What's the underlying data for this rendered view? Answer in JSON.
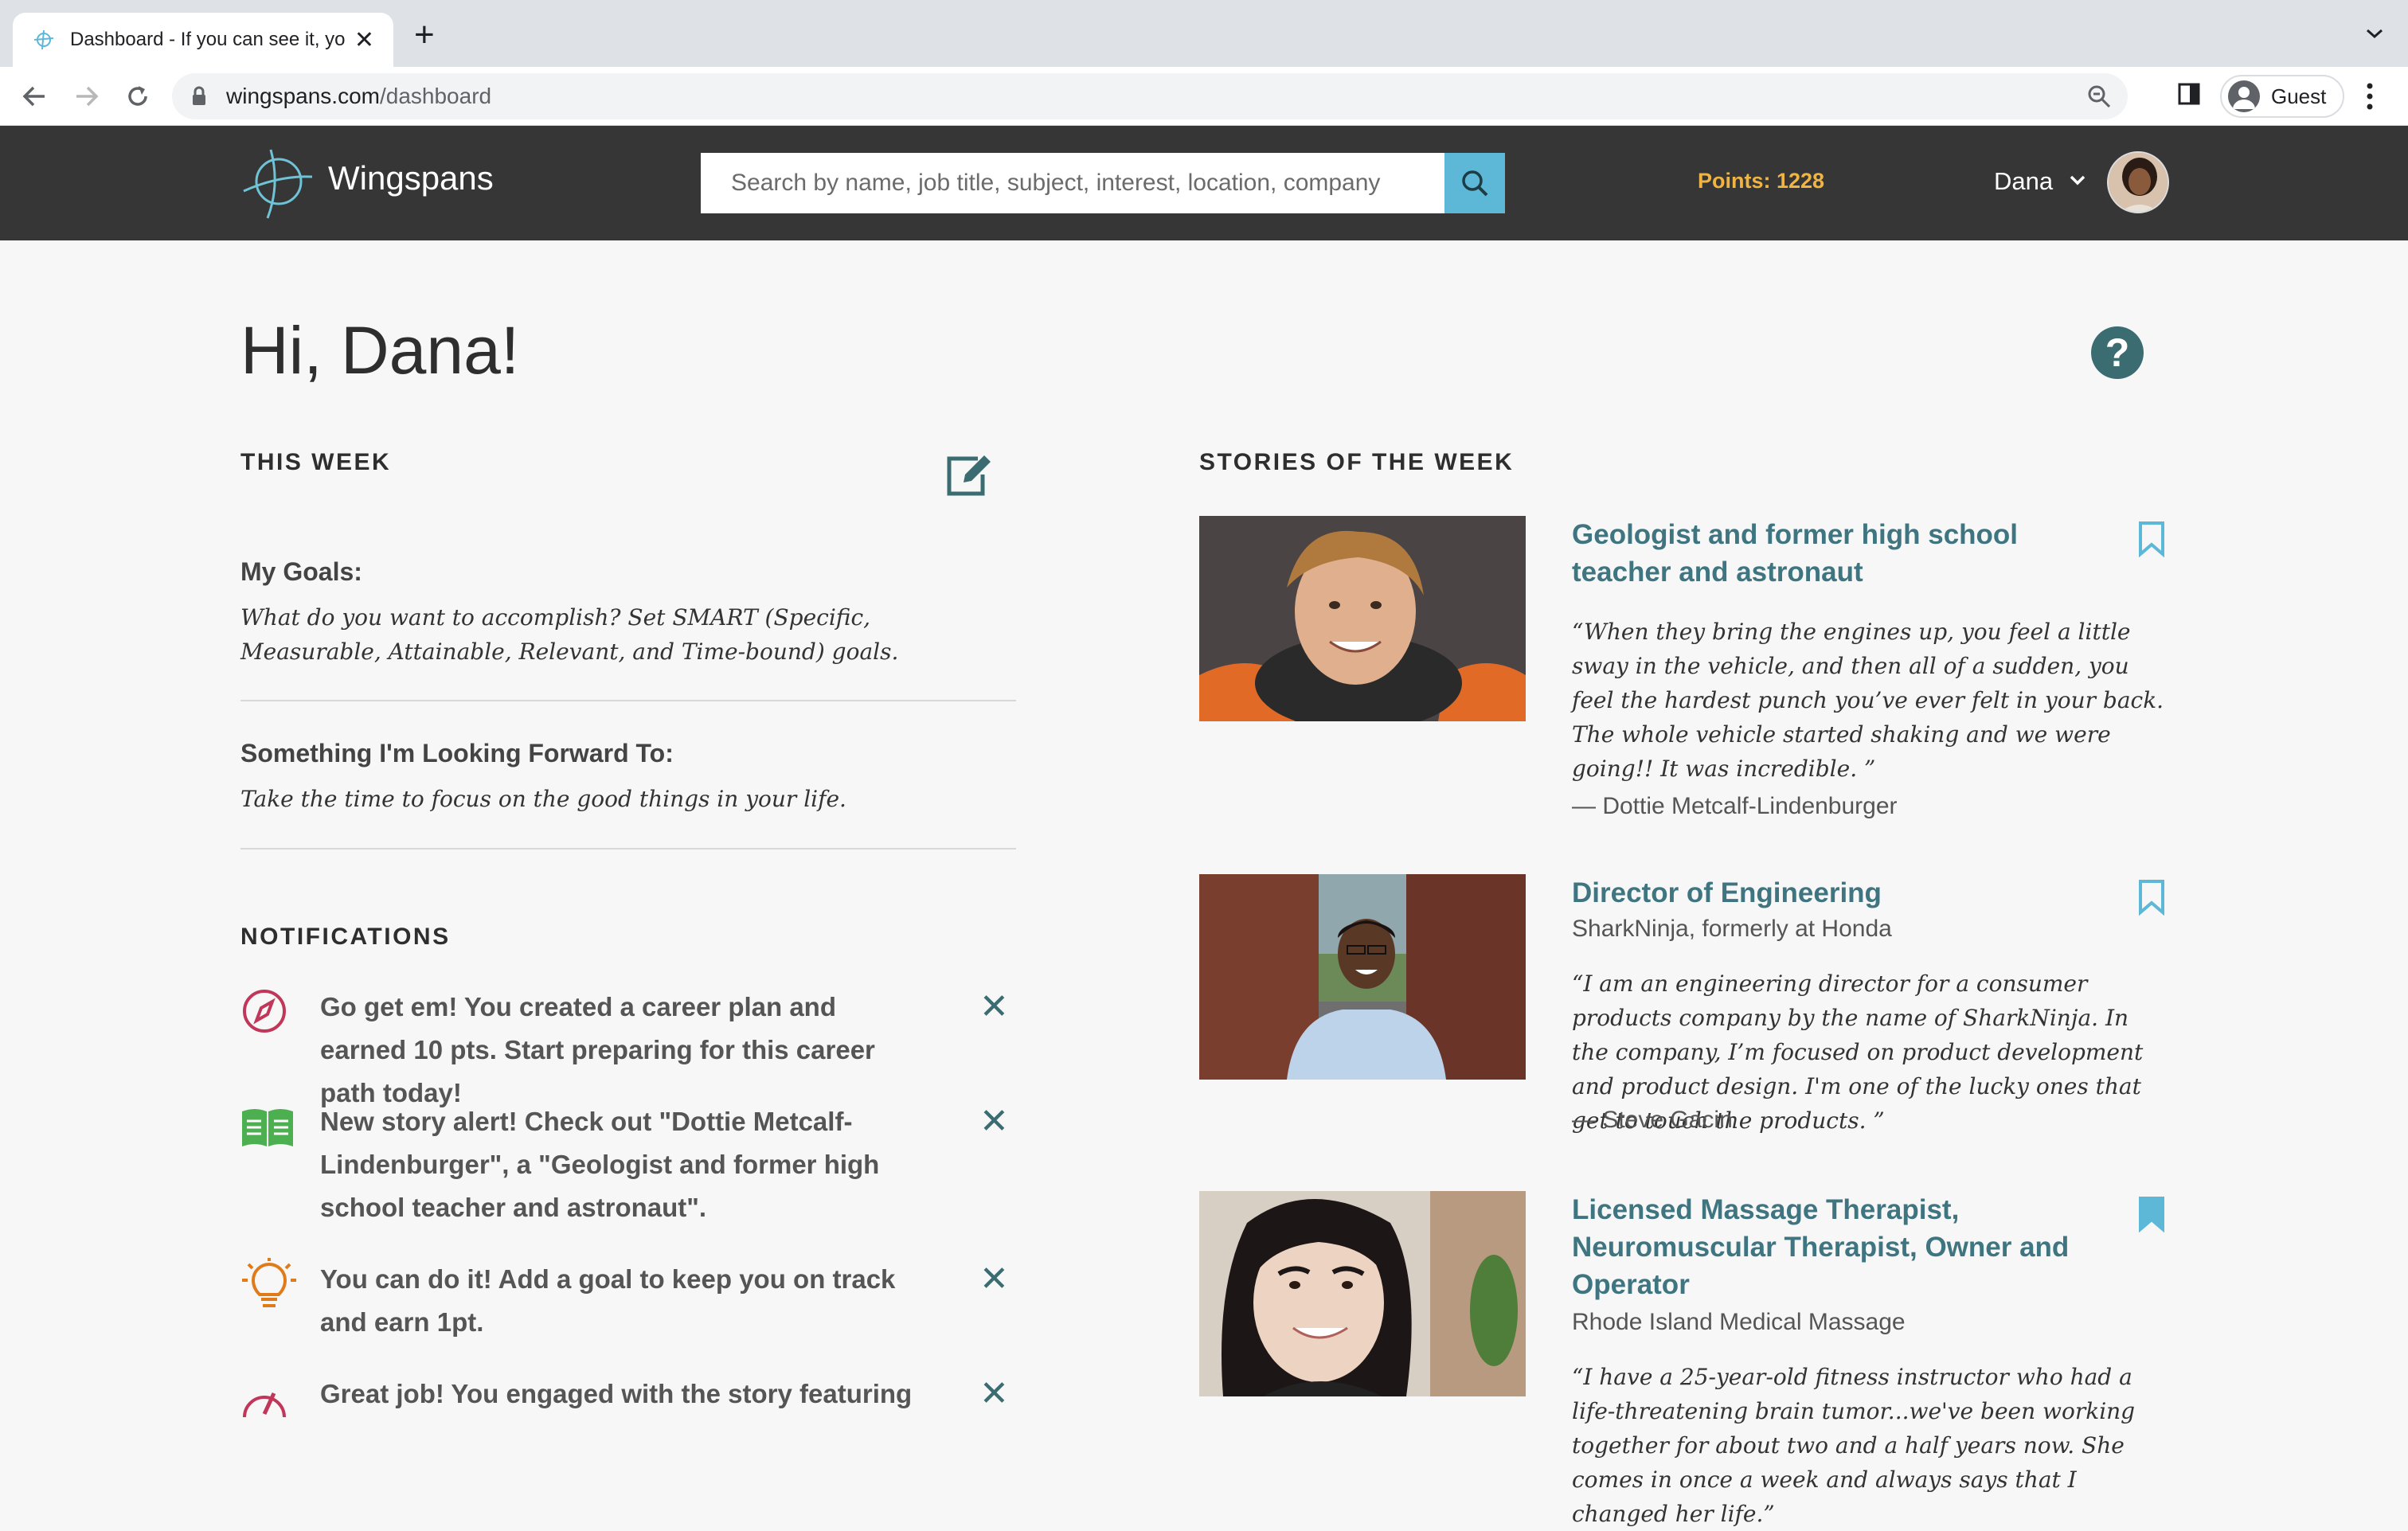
{
  "browser": {
    "tab_title": "Dashboard - If you can see it, you",
    "url_domain": "wingspans.com",
    "url_path": "/dashboard",
    "profile_label": "Guest"
  },
  "header": {
    "brand": "Wingspans",
    "search_placeholder": "Search by name, job title, subject, interest, location, company",
    "points": "Points: 1228",
    "user_name": "Dana"
  },
  "greeting": "Hi, Dana!",
  "this_week": {
    "heading": "THIS WEEK",
    "goals_heading": "My Goals:",
    "goals_text": "What do you want to accomplish? Set SMART (Specific, Measurable, Attainable, Relevant, and Time-bound) goals.",
    "forward_heading": "Something I'm Looking Forward To:",
    "forward_text": "Take the time to focus on the good things in your life."
  },
  "notifications": {
    "heading": "NOTIFICATIONS",
    "items": [
      {
        "icon": "compass-icon",
        "text": "Go get em! You created a career plan and earned 10 pts. Start preparing for this career path today!"
      },
      {
        "icon": "book-icon",
        "text": "New story alert! Check out \"Dottie Metcalf-Lindenburger\", a \"Geologist and former high school teacher and astronaut\"."
      },
      {
        "icon": "lightbulb-icon",
        "text": "You can do it! Add a goal to keep you on track and earn 1pt."
      },
      {
        "icon": "gauge-icon",
        "text": "Great job! You engaged with the story featuring"
      }
    ]
  },
  "stories": {
    "heading": "STORIES OF THE WEEK",
    "items": [
      {
        "title": "Geologist and former high school teacher and astronaut",
        "subtitle": "",
        "quote": "“When they bring the engines up, you feel a little sway in the vehicle, and then all of a sudden, you feel the hardest punch you’ve ever felt in your back. The whole vehicle started shaking and we were going!! It was incredible. ”",
        "author": "— Dottie Metcalf-Lindenburger",
        "bookmarked": false
      },
      {
        "title": "Director of Engineering",
        "subtitle": "SharkNinja, formerly at Honda",
        "quote": "“I am an engineering director for a consumer products company by the name of SharkNinja. In the company, I’m focused on product development and product design. I'm one of the lucky ones that get to touch the products. ”",
        "author": "— Steve Gacin",
        "bookmarked": false
      },
      {
        "title": "Licensed Massage Therapist, Neuromuscular Therapist, Owner and Operator",
        "subtitle": "Rhode Island Medical Massage",
        "quote": "“I have a 25-year-old fitness instructor who had a life-threatening brain tumor...we've been working together for about two and a half years now. She comes in once a week and always says that I changed her life.”",
        "author": "",
        "bookmarked": true
      }
    ]
  },
  "colors": {
    "header_bg": "#363636",
    "accent_teal": "#3f7580",
    "points_gold": "#f0b443",
    "search_button": "#5db7d6",
    "compass_red": "#c0375a",
    "book_green": "#4caf50",
    "bulb_orange": "#e07b1a"
  }
}
